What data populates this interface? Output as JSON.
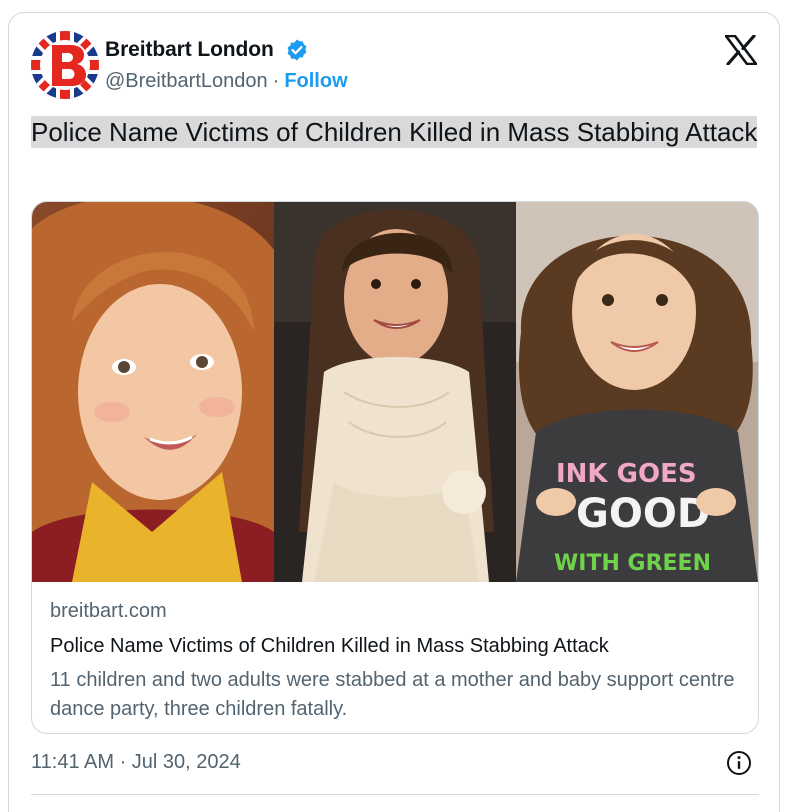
{
  "post": {
    "author_name": "Breitbart London",
    "handle": "@BreitbartLondon",
    "separator": "·",
    "follow_label": "Follow",
    "text": "Police Name Victims of Children Killed in Mass Stabbing Attack",
    "timestamp": "11:41 AM · Jul 30, 2024"
  },
  "link_card": {
    "domain": "breitbart.com",
    "title": "Police Name Victims of Children Killed in Mass Stabbing Attack",
    "description": "11 children and two adults were stabbed at a mother and baby support centre dance party, three children fatally.",
    "photo_shirt_text": [
      "INK GOES",
      "GOOD",
      "WITH GREEN"
    ]
  },
  "icons": {
    "avatar": "breitbart-b-union-jack-logo",
    "verified": "verified-badge-icon",
    "platform": "x-logo-icon",
    "info": "info-icon"
  },
  "colors": {
    "accent": "#1d9bf0",
    "text": "#0f1419",
    "secondary_text": "#536471",
    "border": "#cfd9de",
    "highlight": "#d9d9d9",
    "logo_red": "#e4281f",
    "logo_blue": "#1a3a8c"
  }
}
